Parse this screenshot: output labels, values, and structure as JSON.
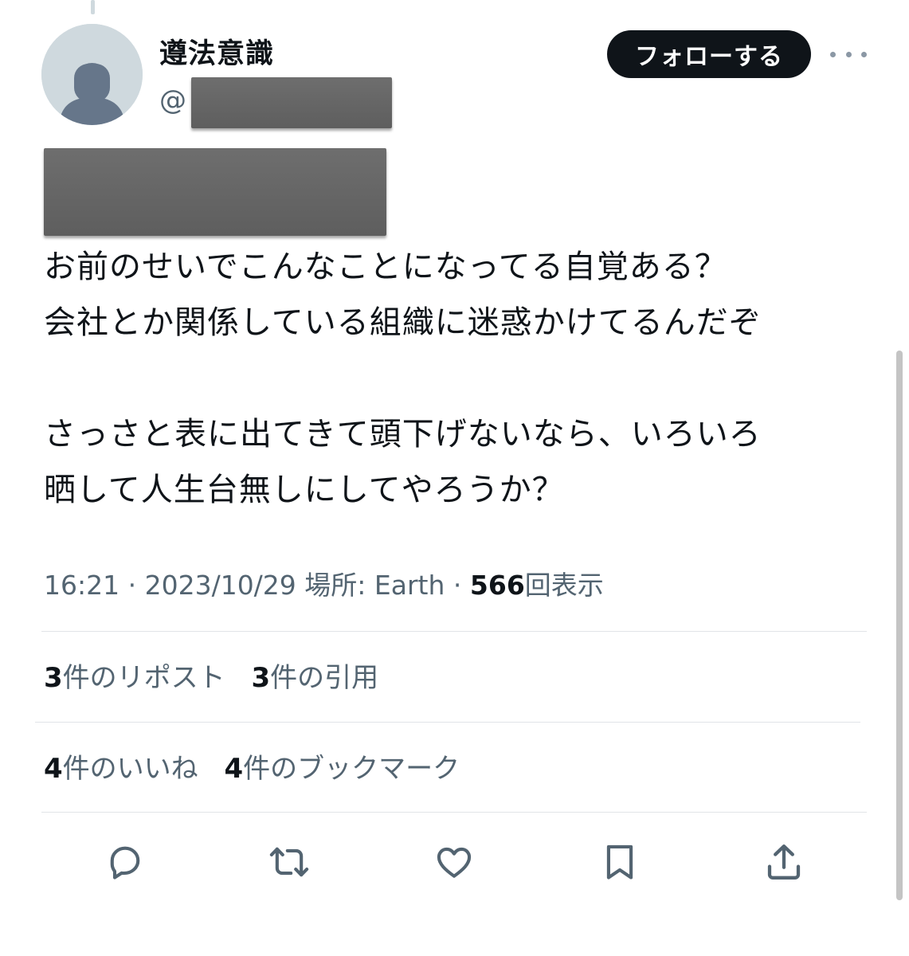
{
  "user": {
    "display_name": "遵法意識",
    "handle_prefix": "@"
  },
  "follow_button": {
    "label": "フォローする"
  },
  "tweet": {
    "lines": [
      "お前のせいでこんなことになってる自覚ある？",
      "会社とか関係している組織に迷惑かけてるんだぞ",
      "",
      "さっさと表に出てきて頭下げないなら、いろいろ",
      "晒して人生台無しにしてやろうか？"
    ]
  },
  "meta": {
    "time": "16:21",
    "date": "2023/10/29",
    "location": "場所: Earth",
    "views_count": "566",
    "views_label": "回表示",
    "separator": " · "
  },
  "stats": {
    "reposts_count": "3",
    "reposts_label": "件のリポスト",
    "quotes_count": "3",
    "quotes_label": "件の引用",
    "likes_count": "4",
    "likes_label": "件のいいね",
    "bookmarks_count": "4",
    "bookmarks_label": "件のブックマーク"
  },
  "actions": [
    "reply-icon",
    "repost-icon",
    "like-icon",
    "bookmark-icon",
    "share-icon"
  ],
  "colors": {
    "text": "#0f1419",
    "secondary": "#536471",
    "divider": "#e1e4e8",
    "button_bg": "#0f1419",
    "avatar_bg": "#cfd9de",
    "avatar_fg": "#5f6f7e",
    "redaction": "#666666"
  }
}
